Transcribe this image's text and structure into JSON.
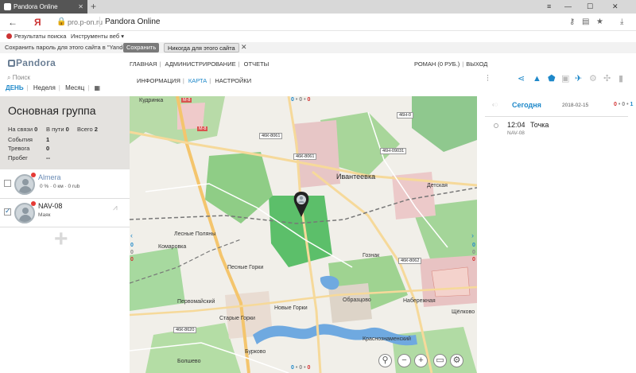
{
  "browser": {
    "tab_title": "Pandora Online",
    "new_tab": "+",
    "url_host": "pro.p-on.ru",
    "page_title": "Pandora Online",
    "nav_back": "←",
    "nav_yandex": "Я",
    "controls": {
      "minimize": "—",
      "maximize": "☐",
      "close": "✕",
      "menu": "≡"
    },
    "bookmarks": [
      {
        "label": "Результаты поиска"
      },
      {
        "label": "Инструменты веб ▾"
      }
    ],
    "password_bar": {
      "text": "Сохранить пароль для этого сайта в \"Yandex\"?",
      "save": "Сохранить",
      "never": "Никогда для этого сайта",
      "close": "✕"
    }
  },
  "app": {
    "logo": "Pandora",
    "top_menu": [
      "ГЛАВНАЯ",
      "АДМИНИСТРИРОВАНИЕ",
      "ОТЧЕТЫ"
    ],
    "user": "РОМАН (0 РУБ.)",
    "logout": "ВЫХОД",
    "sub_menu": [
      "ИНФОРМАЦИЯ",
      "КАРТА",
      "НАСТРОЙКИ"
    ],
    "search_placeholder": "Поиск",
    "periods": [
      "ДЕНЬ",
      "Неделя",
      "Месяц"
    ],
    "colors": {
      "accent": "#1e88c9",
      "alarm": "#d32f2f",
      "panel": "#e4e2df"
    }
  },
  "group": {
    "title": "Основная группа",
    "online_label": "На связи",
    "online": "0",
    "on_way_label": "В пути",
    "on_way": "0",
    "total_label": "Всего",
    "total": "2",
    "events_label": "События",
    "events": "1",
    "alarm_label": "Тревога",
    "alarm": "0",
    "mileage_label": "Пробег",
    "mileage": "--"
  },
  "cars": [
    {
      "name": "Almera",
      "sub": "0 % · 0 км · 0 rub",
      "checked": false
    },
    {
      "name": "NAV-08",
      "sub": "Маяк",
      "checked": true
    }
  ],
  "map": {
    "counter_top": {
      "a": "0",
      "b": "0",
      "c": "0"
    },
    "counter_bottom": {
      "a": "0",
      "b": "0",
      "c": "0"
    },
    "places": {
      "ivanteevka": "Ивантеевка",
      "kudrinka": "Кудринка",
      "lesnye_polyany": "Лесные Поляны",
      "komarovka": "Комаровка",
      "pesnye_gorki": "Песные Горки",
      "goznak": "Гознак",
      "pervomaysky": "Первомайский",
      "starye_gorki": "Старые Горки",
      "novye_gorki": "Новые Горки",
      "obraztsovo": "Образцово",
      "naberezhnaya": "Набережная",
      "shchelkovo": "Щёлково",
      "krasnoznamensky": "Краснознаменский",
      "burkovo": "Бурково",
      "detskaya": "Детская",
      "bolshevo": "Болшево"
    },
    "roads": [
      "46К-8061",
      "46Н-09031",
      "46К-8062",
      "46К-8620",
      "46Н-0"
    ],
    "m8": "М-8",
    "controls": {
      "locate": "⚲",
      "zoom_out": "−",
      "zoom_in": "+",
      "layers": "▭",
      "settings": "⚙"
    },
    "arrow_left": "‹",
    "arrow_right": "›",
    "side_left": {
      "a": "0",
      "b": "0",
      "c": "0"
    },
    "side_right": {
      "a": "0",
      "b": "0",
      "c": "0"
    }
  },
  "events_panel": {
    "back": "‹◌",
    "today": "Сегодня",
    "date": "2018-02-15",
    "counts": {
      "a": "0",
      "b": "0",
      "c": "1"
    },
    "items": [
      {
        "time": "12:04",
        "event": "Точка",
        "car": "NAV-08"
      }
    ]
  }
}
